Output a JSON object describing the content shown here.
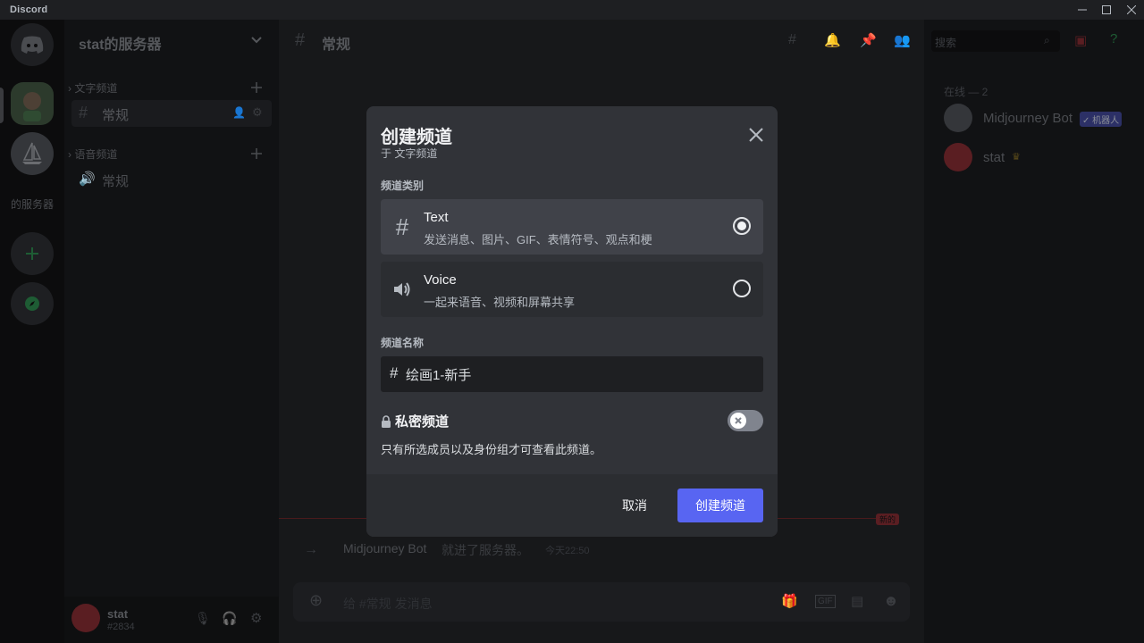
{
  "titlebar": {
    "brand": "Discord"
  },
  "server": {
    "name": "stat的服务器",
    "clipped_name": "的服务器"
  },
  "channels": {
    "text_category": "文字频道",
    "text_channel": "常规",
    "voice_category": "语音频道",
    "voice_channel": "常规"
  },
  "header": {
    "channel": "常规",
    "search_placeholder": "搜索"
  },
  "members": {
    "heading": "在线 — 2",
    "items": [
      {
        "name": "Midjourney Bot",
        "badge": "✓ 机器人"
      },
      {
        "name": "stat"
      }
    ]
  },
  "chat": {
    "new_label": "新的",
    "join_user": "Midjourney Bot",
    "join_text": "就进了服务器。",
    "join_time": "今天22:50",
    "input_placeholder": "给 #常规 发消息"
  },
  "user": {
    "name": "stat",
    "tag": "#2834"
  },
  "modal": {
    "title": "创建频道",
    "subtitle": "于 文字频道",
    "type_label": "频道类别",
    "options": [
      {
        "name": "Text",
        "desc": "发送消息、图片、GIF、表情符号、观点和梗",
        "selected": true
      },
      {
        "name": "Voice",
        "desc": "一起来语音、视频和屏幕共享",
        "selected": false
      }
    ],
    "name_label": "频道名称",
    "name_value": "绘画1-新手",
    "private_label": "私密频道",
    "private_desc": "只有所选成员以及身份组才可查看此频道。",
    "cancel": "取消",
    "create": "创建频道"
  },
  "colors": {
    "accent": "#5865f2",
    "modal_bg": "#313338",
    "footer_bg": "#2b2d31"
  }
}
